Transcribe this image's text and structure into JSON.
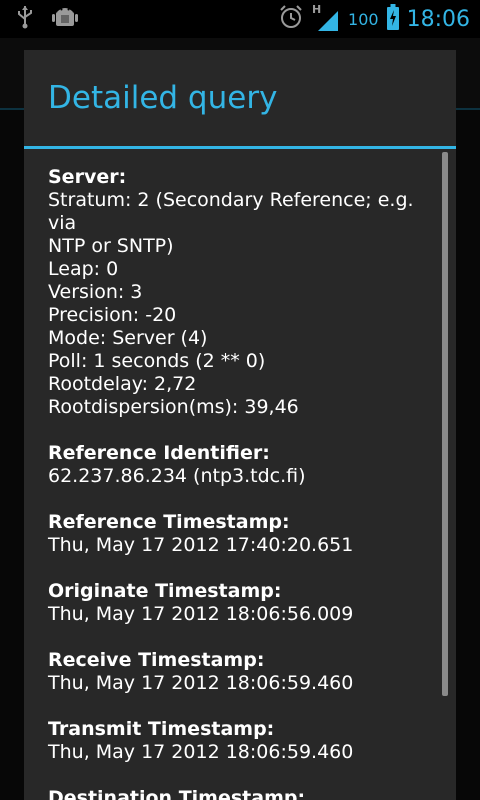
{
  "status_bar": {
    "battery_percent": "100",
    "time": "18:06",
    "network_label": "H"
  },
  "dialog": {
    "title": "Detailed query",
    "server": {
      "heading": "Server:",
      "lines": [
        "Stratum: 2 (Secondary Reference; e.g. via",
        "NTP or SNTP)",
        "Leap: 0",
        "Version: 3",
        "Precision: -20",
        "Mode: Server (4)",
        "Poll: 1 seconds (2 ** 0)",
        "Rootdelay: 2,72",
        "Rootdispersion(ms): 39,46"
      ]
    },
    "reference_identifier": {
      "heading": "Reference Identifier:",
      "value": "62.237.86.234 (ntp3.tdc.fi)"
    },
    "reference_timestamp": {
      "heading": "Reference Timestamp:",
      "value": "Thu, May 17 2012 17:40:20.651"
    },
    "originate_timestamp": {
      "heading": "Originate Timestamp:",
      "value": "Thu, May 17 2012 18:06:56.009"
    },
    "receive_timestamp": {
      "heading": "Receive Timestamp:",
      "value": "Thu, May 17 2012 18:06:59.460"
    },
    "transmit_timestamp": {
      "heading": "Transmit Timestamp:",
      "value": "Thu, May 17 2012 18:06:59.460"
    },
    "destination_timestamp": {
      "heading": "Destination Timestamp:"
    }
  },
  "colors": {
    "accent": "#33b5e5",
    "dialog_bg": "#282828"
  }
}
